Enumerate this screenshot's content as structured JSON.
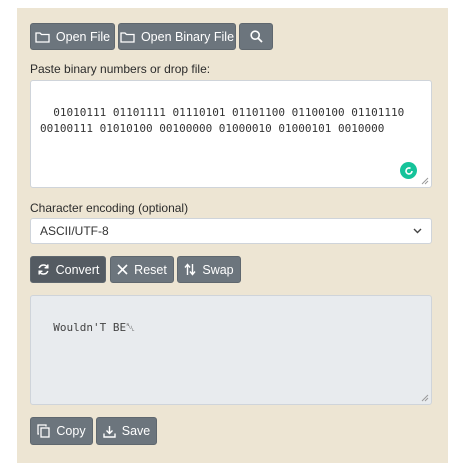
{
  "toolbar": {
    "open_file_label": "Open File",
    "open_binary_file_label": "Open Binary File",
    "search_icon": "search-icon"
  },
  "input": {
    "label": "Paste binary numbers or drop file:",
    "value": "01010111 01101111 01110101 01101100 01100100 01101110 00100111 01010100 00100000 01000010 01000101 0010000"
  },
  "encoding": {
    "label": "Character encoding (optional)",
    "selected": "ASCII/UTF-8"
  },
  "actions": {
    "convert_label": "Convert",
    "reset_label": "Reset",
    "swap_label": "Swap"
  },
  "output": {
    "value": "Wouldn'T BE␀"
  },
  "bottom": {
    "copy_label": "Copy",
    "save_label": "Save"
  },
  "colors": {
    "panel": "#ede5d3",
    "button": "#6c757d",
    "grammarly": "#15c39a"
  }
}
